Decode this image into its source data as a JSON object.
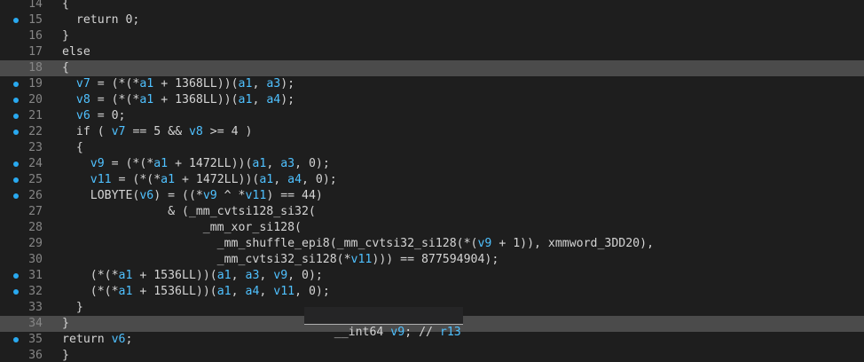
{
  "colors": {
    "background": "#1e1e1e",
    "highlight": "#4b4b4b",
    "breakpoint": "#29a9f0",
    "identifier": "#4fc1ff",
    "text": "#d4d4d4",
    "line_number": "#858585"
  },
  "lines": [
    {
      "no": "14",
      "bp": false,
      "text": "{"
    },
    {
      "no": "15",
      "bp": true,
      "text": "  return 0;"
    },
    {
      "no": "16",
      "bp": false,
      "text": "}"
    },
    {
      "no": "17",
      "bp": false,
      "text": "else"
    },
    {
      "no": "18",
      "bp": false,
      "text": "{"
    },
    {
      "no": "19",
      "bp": true,
      "text": "  v7 = (*(*a1 + 1368LL))(a1, a3);"
    },
    {
      "no": "20",
      "bp": true,
      "text": "  v8 = (*(*a1 + 1368LL))(a1, a4);"
    },
    {
      "no": "21",
      "bp": true,
      "text": "  v6 = 0;"
    },
    {
      "no": "22",
      "bp": true,
      "text": "  if ( v7 == 5 && v8 >= 4 )"
    },
    {
      "no": "23",
      "bp": false,
      "text": "  {"
    },
    {
      "no": "24",
      "bp": true,
      "text": "    v9 = (*(*a1 + 1472LL))(a1, a3, 0);"
    },
    {
      "no": "25",
      "bp": true,
      "text": "    v11 = (*(*a1 + 1472LL))(a1, a4, 0);"
    },
    {
      "no": "26",
      "bp": true,
      "text": "    LOBYTE(v6) = ((*v9 ^ *v11) == 44)"
    },
    {
      "no": "27",
      "bp": false,
      "text": "               & (_mm_cvtsi128_si32("
    },
    {
      "no": "28",
      "bp": false,
      "text": "                    _mm_xor_si128("
    },
    {
      "no": "29",
      "bp": false,
      "text": "                      _mm_shuffle_epi8(_mm_cvtsi32_si128(*(v9 + 1)), xmmword_3DD20),"
    },
    {
      "no": "30",
      "bp": false,
      "text": "                      _mm_cvtsi32_si128(*v11))) == 877594904);"
    },
    {
      "no": "31",
      "bp": true,
      "text": "    (*(*a1 + 1536LL))(a1, a3, v9, 0);"
    },
    {
      "no": "32",
      "bp": true,
      "text": "    (*(*a1 + 1536LL))(a1, a4, v11, 0);"
    },
    {
      "no": "33",
      "bp": false,
      "text": "  }"
    },
    {
      "no": "34",
      "bp": false,
      "text": "}"
    },
    {
      "no": "35",
      "bp": true,
      "text": "return v6;"
    },
    {
      "no": "36",
      "bp": false,
      "text": "}"
    }
  ],
  "highlighted_lines": [
    "18",
    "34"
  ],
  "tooltip": "__int64 v9; // r13"
}
